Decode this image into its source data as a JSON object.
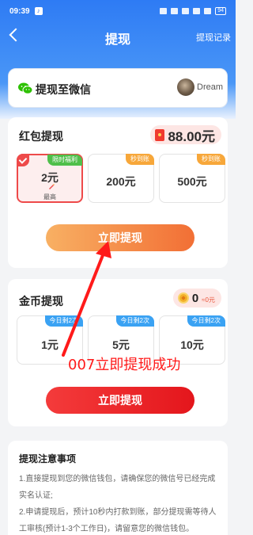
{
  "status": {
    "time": "09:39",
    "battery": "94"
  },
  "nav": {
    "title": "提现",
    "history_link": "提现记录"
  },
  "wechat": {
    "label": "提现至微信",
    "username": "Dream"
  },
  "redpack": {
    "title": "红包提现",
    "balance": "88.00元",
    "options": [
      {
        "tag": "限时福利",
        "amount": "2元",
        "sub": "最高",
        "selected": true
      },
      {
        "tag": "秒到账",
        "amount": "200元"
      },
      {
        "tag": "秒到账",
        "amount": "500元"
      }
    ],
    "button": "立即提现"
  },
  "coins": {
    "title": "金币提现",
    "balance": "0",
    "balance_sub": "≈0元",
    "options": [
      {
        "tag": "今日剩2次",
        "amount": "1元"
      },
      {
        "tag": "今日剩2次",
        "amount": "5元"
      },
      {
        "tag": "今日剩2次",
        "amount": "10元"
      }
    ],
    "button": "立即提现"
  },
  "annotation": "007立即提现成功",
  "notes": {
    "title": "提现注意事项",
    "lines": [
      "1.直接提现到您的微信钱包，请确保您的微信号已经完成实名认证;",
      "2.申请提现后，预计10秒内打款到账，部分提现需等待人工审核(预计1-3个工作日)，请留意您的微信钱包。"
    ]
  },
  "colors": {
    "header_blue": "#2e7bf4",
    "accent_red": "#ee4a4a",
    "button_orange": "#f26f35",
    "annotation_red": "#ff1a1a"
  }
}
